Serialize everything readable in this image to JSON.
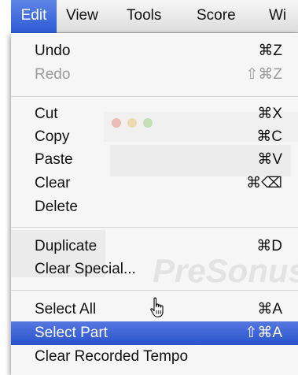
{
  "menubar": {
    "items": [
      {
        "label": "Edit",
        "active": true
      },
      {
        "label": "View",
        "active": false
      },
      {
        "label": "Tools",
        "active": false
      },
      {
        "label": "Score",
        "active": false
      },
      {
        "label": "Wi",
        "active": false
      }
    ]
  },
  "edit_menu": {
    "undo": {
      "label": "Undo",
      "shortcut": "⌘Z",
      "enabled": true
    },
    "redo": {
      "label": "Redo",
      "shortcut": "⇧⌘Z",
      "enabled": false
    },
    "cut": {
      "label": "Cut",
      "shortcut": "⌘X"
    },
    "copy": {
      "label": "Copy",
      "shortcut": "⌘C"
    },
    "paste": {
      "label": "Paste",
      "shortcut": "⌘V"
    },
    "clear": {
      "label": "Clear",
      "shortcut": "⌘⌫"
    },
    "delete": {
      "label": "Delete",
      "shortcut": ""
    },
    "duplicate": {
      "label": "Duplicate",
      "shortcut": "⌘D"
    },
    "clear_special": {
      "label": "Clear Special...",
      "shortcut": ""
    },
    "select_all": {
      "label": "Select All",
      "shortcut": "⌘A"
    },
    "select_part": {
      "label": "Select Part",
      "shortcut": "⇧⌘A",
      "highlighted": true
    },
    "clear_recorded_tempo": {
      "label": "Clear Recorded Tempo",
      "shortcut": ""
    }
  },
  "background": {
    "watermark_brand": "PreSonus"
  },
  "colors": {
    "highlight": "#2e5bd4",
    "menu_background": "#f6f6f6",
    "disabled_text": "#9a9a9a"
  },
  "cursor": {
    "icon": "pointing-hand-cursor"
  }
}
